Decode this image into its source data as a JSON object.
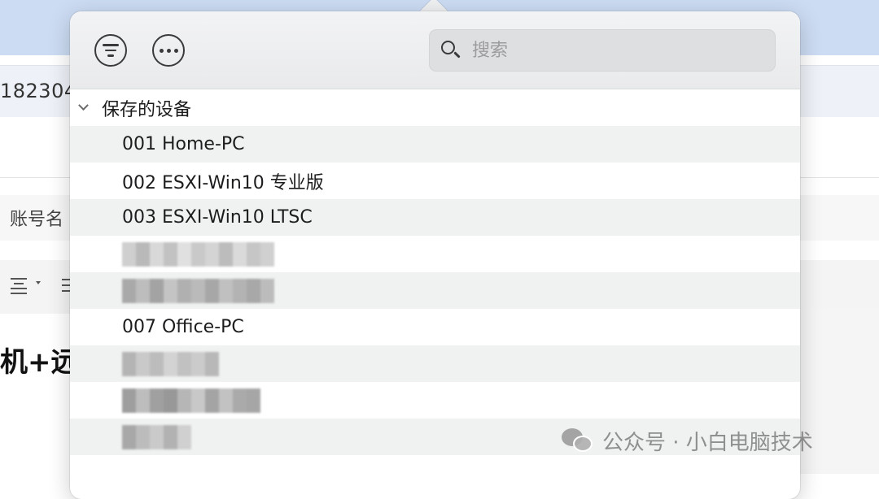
{
  "background": {
    "url_fragment": "182304",
    "field_label": "账号名",
    "heading_fragment": "机+远"
  },
  "popover": {
    "header": {
      "filter_button_icon": "filter-icon",
      "more_button_icon": "more-icon",
      "search": {
        "placeholder": "搜索",
        "value": "",
        "icon": "search-icon"
      }
    },
    "group": {
      "label": "保存的设备",
      "expanded": true
    },
    "devices": [
      {
        "label": "001 Home-PC",
        "redacted": false
      },
      {
        "label": "002 ESXI-Win10 专业版",
        "redacted": false
      },
      {
        "label": "003 ESXI-Win10 LTSC",
        "redacted": false
      },
      {
        "label": "",
        "redacted": true
      },
      {
        "label": "",
        "redacted": true
      },
      {
        "label": "007 Office-PC",
        "redacted": false
      },
      {
        "label": "",
        "redacted": true
      },
      {
        "label": "",
        "redacted": true
      },
      {
        "label": "",
        "redacted": true
      }
    ]
  },
  "watermark": {
    "text": "公众号 · 小白电脑技术",
    "icon": "wechat-icon"
  },
  "colors": {
    "top_bar": "#ccdcf3",
    "row_alt": "#f0f2f1",
    "text": "#1d1d1f",
    "search_bg": "#dedfe1"
  }
}
